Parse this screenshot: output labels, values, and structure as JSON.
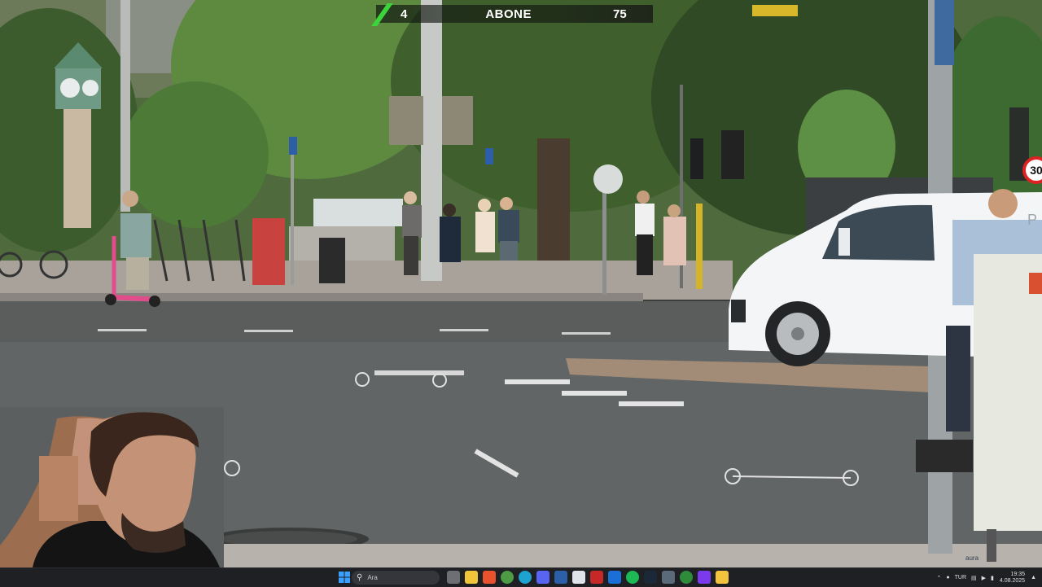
{
  "overlay": {
    "left_count": "4",
    "title": "ABONE",
    "right_count": "75"
  },
  "scene": {
    "speed_sign": "30",
    "van_label": "P"
  },
  "watermark": "aura",
  "taskbar": {
    "search_placeholder": "Ara",
    "language": "TUR",
    "time": "19:35",
    "date": "4.08.2025",
    "apps": [
      "file-explorer-icon",
      "browser-brave-icon",
      "chrome-icon",
      "edge-icon",
      "discord-icon",
      "screen-icon",
      "app-icon",
      "app-icon-2",
      "spotify-icon",
      "app-icon-3",
      "steam-icon",
      "app-icon-4",
      "xbox-icon",
      "app-icon-5",
      "folder-icon"
    ]
  }
}
